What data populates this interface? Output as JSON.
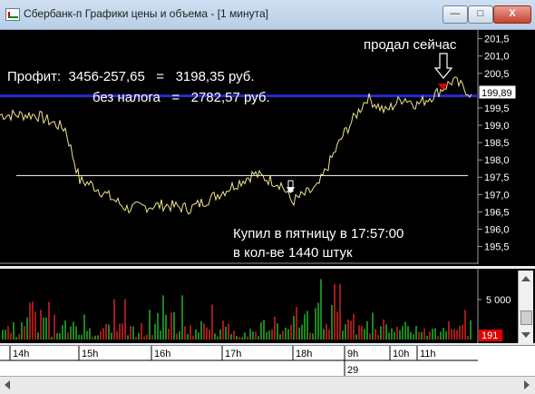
{
  "window": {
    "title": "Сбербанк-п Графики цены и объема - [1 минута]",
    "min_label": "—",
    "max_label": "□",
    "close_label": "X"
  },
  "price_axis": {
    "ticks": [
      "201,5",
      "201,0",
      "200,5",
      "200,0",
      "199,5",
      "199,0",
      "198,5",
      "198,0",
      "197,5",
      "197,0",
      "196,5",
      "196,0",
      "195,5"
    ],
    "current": "199,89"
  },
  "volume_axis": {
    "tick": "5 000",
    "current": "191"
  },
  "annotations": {
    "profit_line1": "Профит:  3456-257,65   =   3198,35 руб.",
    "profit_line2": "без налога   =   2782,57 руб.",
    "sold": "продал сейчас",
    "bought_line1": "Купил в пятницу в 17:57:00",
    "bought_line2": "в кол-ве 1440 штук"
  },
  "time_axis": {
    "labels": [
      "14h",
      "15h",
      "16h",
      "17h",
      "18h",
      "9h",
      "10h",
      "11h"
    ],
    "date_label": "29"
  },
  "colors": {
    "price_line": "#f0e68c",
    "level_line": "#2020a0",
    "volume_green": "#22aa22",
    "volume_red": "#cc2020",
    "current_price_box": "#ffffff",
    "current_volume_box": "#e00000"
  },
  "chart_data": [
    {
      "type": "line",
      "title": "",
      "xlabel": "",
      "ylabel": "",
      "x": [
        "13:30",
        "14:00",
        "14:30",
        "14:40",
        "15:00",
        "15:30",
        "16:00",
        "16:30",
        "17:00",
        "17:30",
        "17:57",
        "18:10",
        "18:30",
        "18:45",
        "9:00",
        "9:20",
        "9:40",
        "10:00",
        "10:30",
        "11:00",
        "11:30"
      ],
      "values": [
        199.3,
        199.3,
        198.9,
        197.4,
        197.3,
        196.6,
        196.7,
        196.6,
        197.0,
        197.6,
        197.3,
        196.8,
        197.2,
        198.7,
        199.8,
        199.4,
        199.8,
        199.6,
        199.9,
        200.3,
        199.9
      ],
      "ylim": [
        195.2,
        201.7
      ],
      "yticks": [
        195.5,
        196.0,
        196.5,
        197.0,
        197.5,
        198.0,
        198.5,
        199.0,
        199.5,
        200.0,
        200.5,
        201.0,
        201.5
      ],
      "reference_lines": [
        197.55,
        199.85
      ],
      "grid": false
    },
    {
      "type": "bar",
      "title": "",
      "x": [
        "14h",
        "15h",
        "16h",
        "17h",
        "18h",
        "9h",
        "10h",
        "11h"
      ],
      "series": [
        {
          "values": [
            1800,
            2300,
            3800,
            2600,
            2900,
            3100,
            4600,
            3400,
            2600,
            1800,
            3400,
            5200,
            6300,
            3200,
            2800,
            3100,
            2000,
            3800
          ]
        },
        {
          "values": [
            1400,
            6800,
            2600,
            2100,
            4200,
            1700,
            2800,
            3000,
            6600,
            1900,
            2400,
            3400,
            5800,
            4400,
            2100,
            2700,
            2500,
            3100
          ]
        }
      ],
      "yticks": [
        5000
      ],
      "grid": false
    }
  ]
}
